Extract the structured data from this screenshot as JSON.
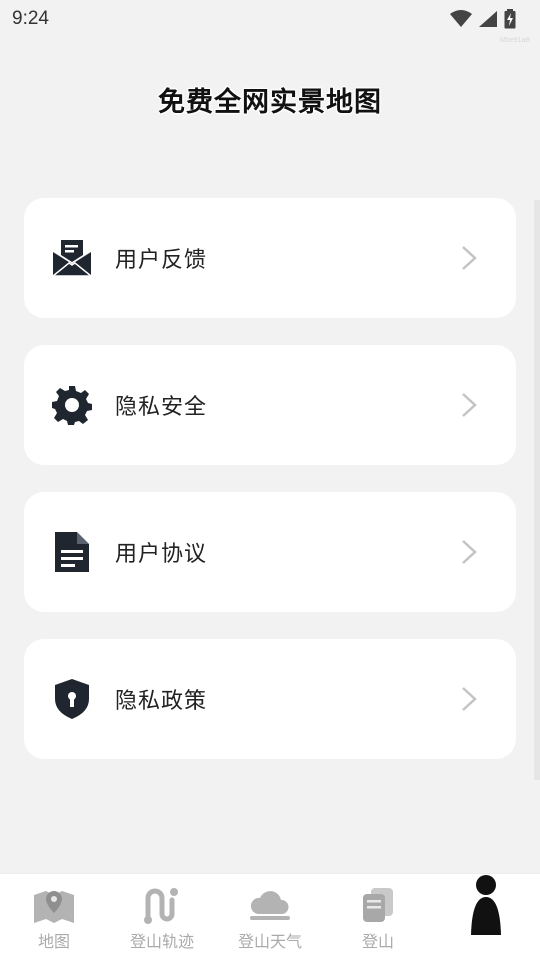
{
  "status_bar": {
    "time": "9:24",
    "icons": [
      "wifi-icon",
      "signal-icon",
      "battery-charging-icon"
    ]
  },
  "watermark": "Mbe91aB",
  "page": {
    "title": "免费全网实景地图"
  },
  "menu": {
    "items": [
      {
        "label": "用户反馈",
        "icon": "feedback-mail-icon"
      },
      {
        "label": "隐私安全",
        "icon": "gear-icon"
      },
      {
        "label": "用户协议",
        "icon": "document-icon"
      },
      {
        "label": "隐私政策",
        "icon": "shield-lock-icon"
      }
    ]
  },
  "tabbar": {
    "tabs": [
      {
        "label": "地图",
        "icon": "map-pin-icon"
      },
      {
        "label": "登山轨迹",
        "icon": "track-icon"
      },
      {
        "label": "登山天气",
        "icon": "cloud-icon"
      },
      {
        "label": "登山",
        "icon": "cards-icon"
      },
      {
        "label": "",
        "icon": "person-icon",
        "active": true
      }
    ]
  },
  "colors": {
    "background": "#f2f2f2",
    "card": "#ffffff",
    "icon_dark": "#1f2630",
    "tab_inactive": "#aaaaaa"
  }
}
